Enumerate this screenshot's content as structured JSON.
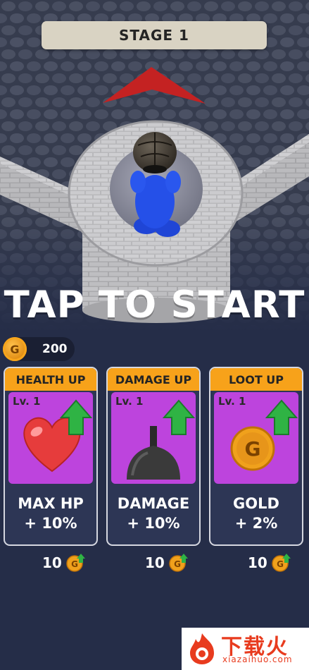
{
  "stage": {
    "label": "STAGE 1"
  },
  "prompt": {
    "label": "TAP TO START"
  },
  "wallet": {
    "coin_symbol": "G",
    "amount": "200"
  },
  "upgrades": [
    {
      "title": "HEALTH UP",
      "level": "Lv. 1",
      "line1": "MAX HP",
      "line2": "+ 10%",
      "cost": "10",
      "icon": "heart-icon"
    },
    {
      "title": "DAMAGE UP",
      "level": "Lv. 1",
      "line1": "DAMAGE",
      "line2": "+ 10%",
      "cost": "10",
      "icon": "kettlebell-icon"
    },
    {
      "title": "LOOT UP",
      "level": "Lv. 1",
      "line1": "GOLD",
      "line2": "+ 2%",
      "cost": "10",
      "icon": "gold-coin-icon"
    }
  ],
  "watermark": {
    "title": "下载火",
    "url": "xiazaihuo.com"
  },
  "colors": {
    "header_orange": "#f7a21a",
    "card_purple": "#bd44dd",
    "background": "#252d48"
  }
}
